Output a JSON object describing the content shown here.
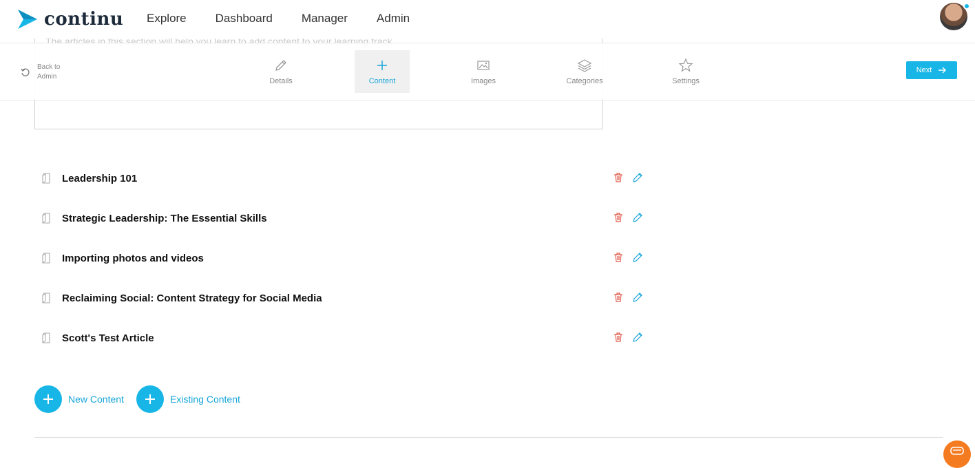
{
  "brand": {
    "name": "continu",
    "accent": "#17b6e6"
  },
  "nav": {
    "links": [
      "Explore",
      "Dashboard",
      "Manager",
      "Admin"
    ]
  },
  "subbar": {
    "back_label": "Back to Admin",
    "ghost_text": "The articles in this section will help you learn to add content to your learning track",
    "steps": [
      {
        "label": "Details",
        "icon": "pencil-icon"
      },
      {
        "label": "Content",
        "icon": "plus-icon"
      },
      {
        "label": "Images",
        "icon": "image-icon"
      },
      {
        "label": "Categories",
        "icon": "layers-icon"
      },
      {
        "label": "Settings",
        "icon": "star-icon"
      }
    ],
    "active_step": "Content",
    "next_label": "Next"
  },
  "content_items": [
    {
      "title": "Leadership 101"
    },
    {
      "title": "Strategic Leadership: The Essential Skills"
    },
    {
      "title": "Importing photos and videos"
    },
    {
      "title": "Reclaiming Social: Content Strategy for Social Media"
    },
    {
      "title": "Scott's Test Article"
    }
  ],
  "actions": {
    "new_content_label": "New Content",
    "existing_content_label": "Existing Content"
  },
  "colors": {
    "delete": "#e05a4a",
    "edit": "#1aa6d8",
    "chat": "#f47b20"
  }
}
